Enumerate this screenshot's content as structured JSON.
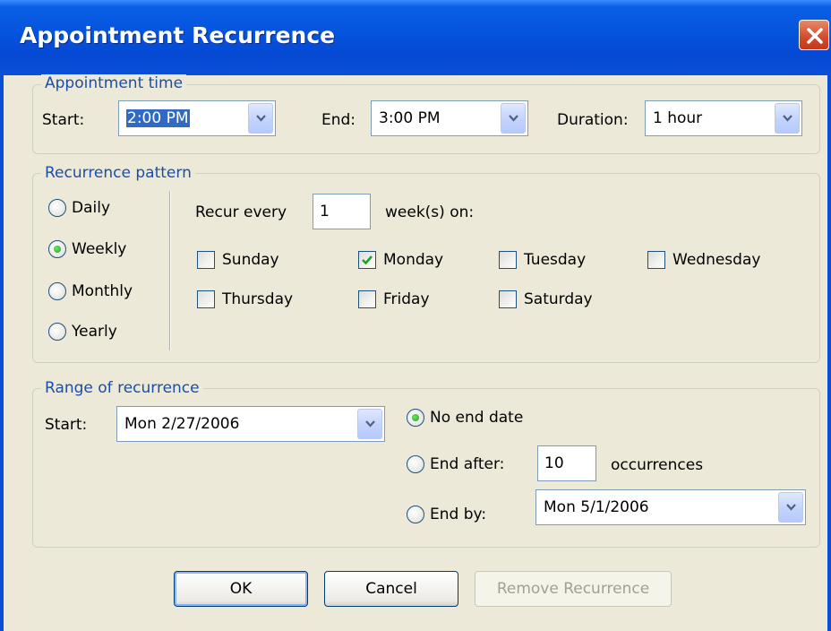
{
  "window": {
    "title": "Appointment Recurrence"
  },
  "appointment_time": {
    "legend": "Appointment time",
    "start_label": "Start:",
    "start_value": "2:00 PM",
    "end_label": "End:",
    "end_value": "3:00 PM",
    "duration_label": "Duration:",
    "duration_value": "1 hour"
  },
  "recurrence_pattern": {
    "legend": "Recurrence pattern",
    "frequencies": [
      {
        "label": "Daily",
        "selected": false
      },
      {
        "label": "Weekly",
        "selected": true
      },
      {
        "label": "Monthly",
        "selected": false
      },
      {
        "label": "Yearly",
        "selected": false
      }
    ],
    "recur_every_label": "Recur every",
    "recur_every_value": "1",
    "weeks_on_label": "week(s) on:",
    "days": [
      {
        "label": "Sunday",
        "checked": false
      },
      {
        "label": "Monday",
        "checked": true
      },
      {
        "label": "Tuesday",
        "checked": false
      },
      {
        "label": "Wednesday",
        "checked": false
      },
      {
        "label": "Thursday",
        "checked": false
      },
      {
        "label": "Friday",
        "checked": false
      },
      {
        "label": "Saturday",
        "checked": false
      }
    ]
  },
  "range": {
    "legend": "Range of recurrence",
    "start_label": "Start:",
    "start_value": "Mon 2/27/2006",
    "no_end_label": "No end date",
    "end_after_label": "End after:",
    "end_after_value": "10",
    "occurrences_label": "occurrences",
    "end_by_label": "End by:",
    "end_by_value": "Mon 5/1/2006",
    "selected_option": "No end date"
  },
  "buttons": {
    "ok": "OK",
    "cancel": "Cancel",
    "remove": "Remove Recurrence"
  },
  "colors": {
    "title_bar": "#0553dd",
    "dialog_bg": "#ece9d8",
    "group_label": "#1b4ea8",
    "selection": "#316ac5",
    "close_button": "#d3492b"
  }
}
